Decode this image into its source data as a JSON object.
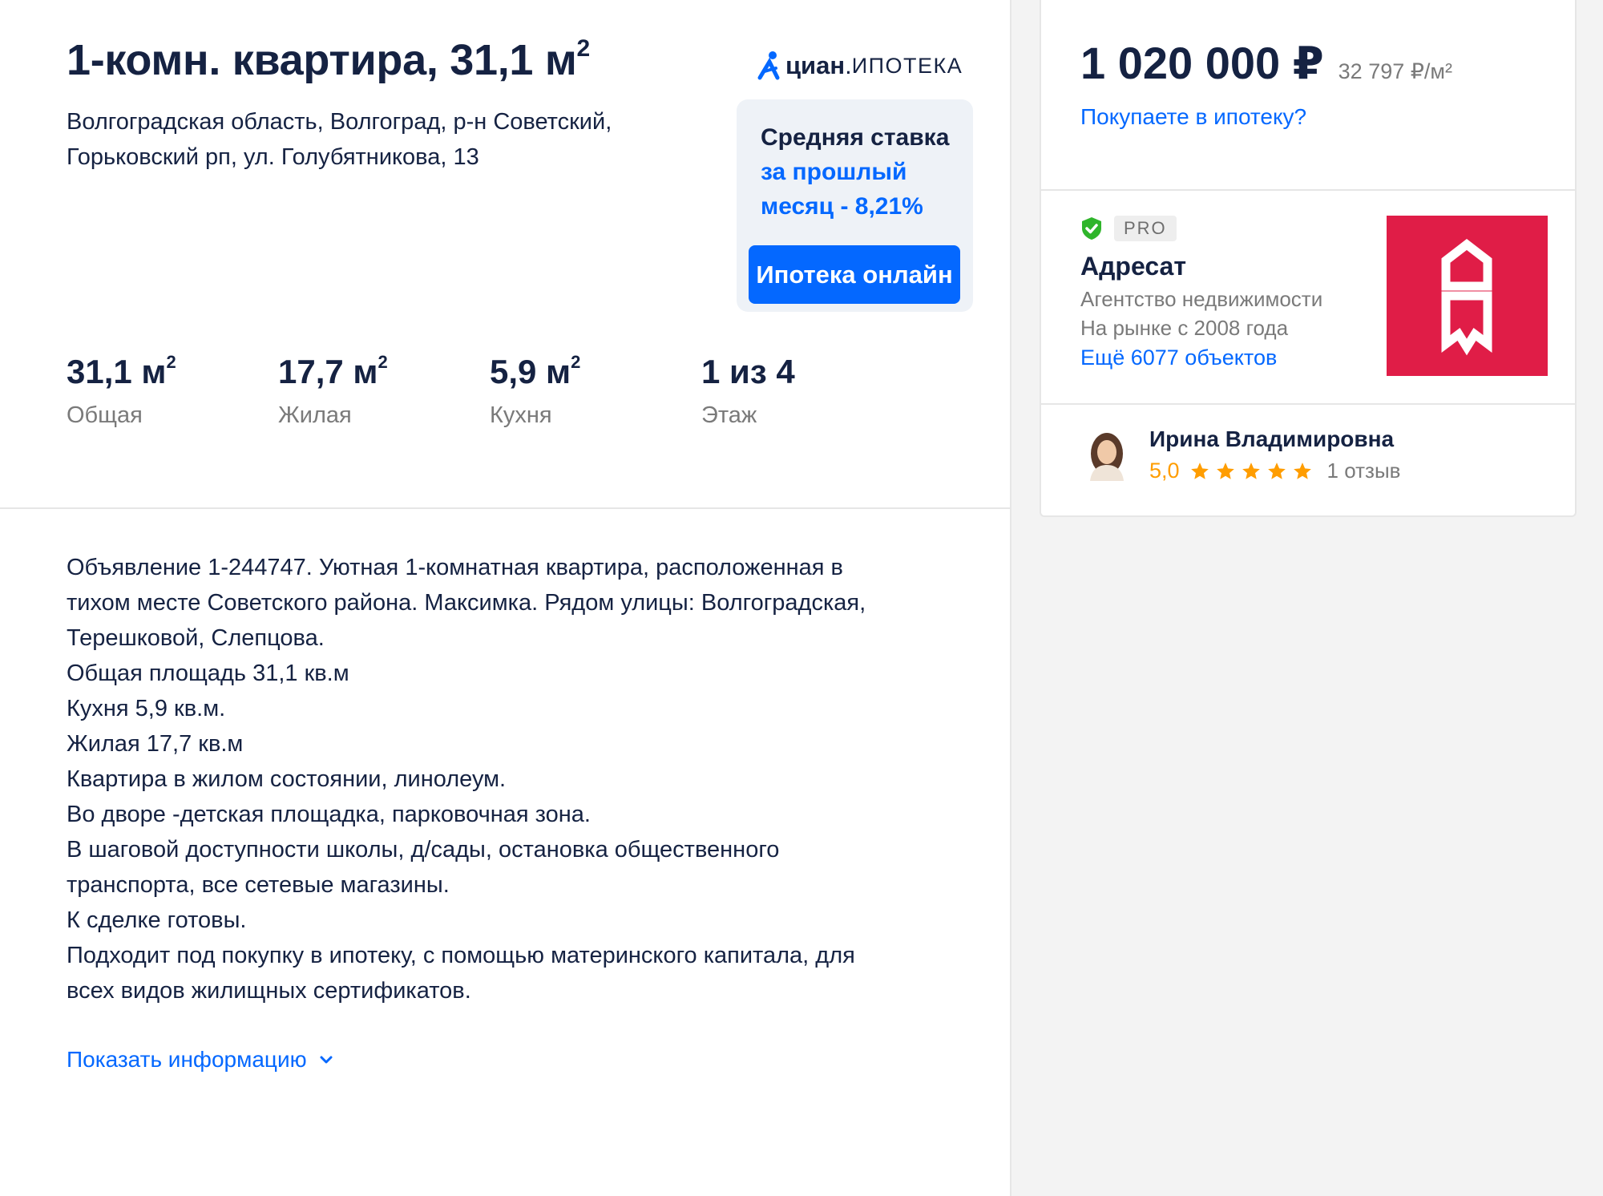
{
  "listing": {
    "title_main": "1-комн. квартира, 31,1 м",
    "title_sup": "2",
    "address_line1": "Волгоградская область, Волгоград, р-н Советский,",
    "address_line2": "Горьковский рп, ул. Голубятникова, 13"
  },
  "mortgage_widget": {
    "logo_brand": "циан",
    "logo_dot": ".",
    "logo_sub": "ИПОТЕКА",
    "rate_line1": "Средняя ставка",
    "rate_line2": "за прошлый",
    "rate_line3": "месяц - 8,21%",
    "button_label": "Ипотека онлайн"
  },
  "facts": [
    {
      "value": "31,1 м",
      "sup": "2",
      "label": "Общая"
    },
    {
      "value": "17,7 м",
      "sup": "2",
      "label": "Жилая"
    },
    {
      "value": "5,9 м",
      "sup": "2",
      "label": "Кухня"
    },
    {
      "value": "1 из 4",
      "sup": "",
      "label": "Этаж"
    }
  ],
  "description": {
    "lines": [
      "Объявление 1-244747. Уютная 1-комнатная квартира, расположенная в",
      "тихом месте Советского района. Максимка. Рядом улицы: Волгоградская,",
      "Терешковой, Слепцова.",
      "Общая площадь 31,1 кв.м",
      "Кухня 5,9 кв.м.",
      "Жилая 17,7 кв.м",
      "Квартира в жилом состоянии, линолеум.",
      "Во дворе -детская площадка, парковочная зона.",
      "В шаговой доступности школы, д/сады, остановка общественного",
      "транспорта, все сетевые магазины.",
      "К сделке готовы.",
      "Подходит под покупку в ипотеку, с помощью материнского капитала, для",
      "всех видов жилищных сертификатов."
    ],
    "show_more": "Показать информацию"
  },
  "sidebar": {
    "price": "1 020 000 ₽",
    "price_per_m2": "32 797 ₽/м²",
    "mortgage_link": "Покупаете в ипотеку?",
    "agency": {
      "badge": "PRO",
      "name": "Адресат",
      "type": "Агентство недвижимости",
      "since": "На рынке с 2008 года",
      "more_link": "Ещё 6077 объектов"
    },
    "agent": {
      "name": "Ирина Владимировна",
      "rating": "5,0",
      "stars": 5,
      "reviews": "1 отзыв"
    }
  },
  "colors": {
    "text": "#152242",
    "accent": "#0468ff",
    "muted": "#7a7a7a",
    "rating": "#ff9d00",
    "verified": "#2fb52b",
    "agency_logo": "#e01d47"
  }
}
